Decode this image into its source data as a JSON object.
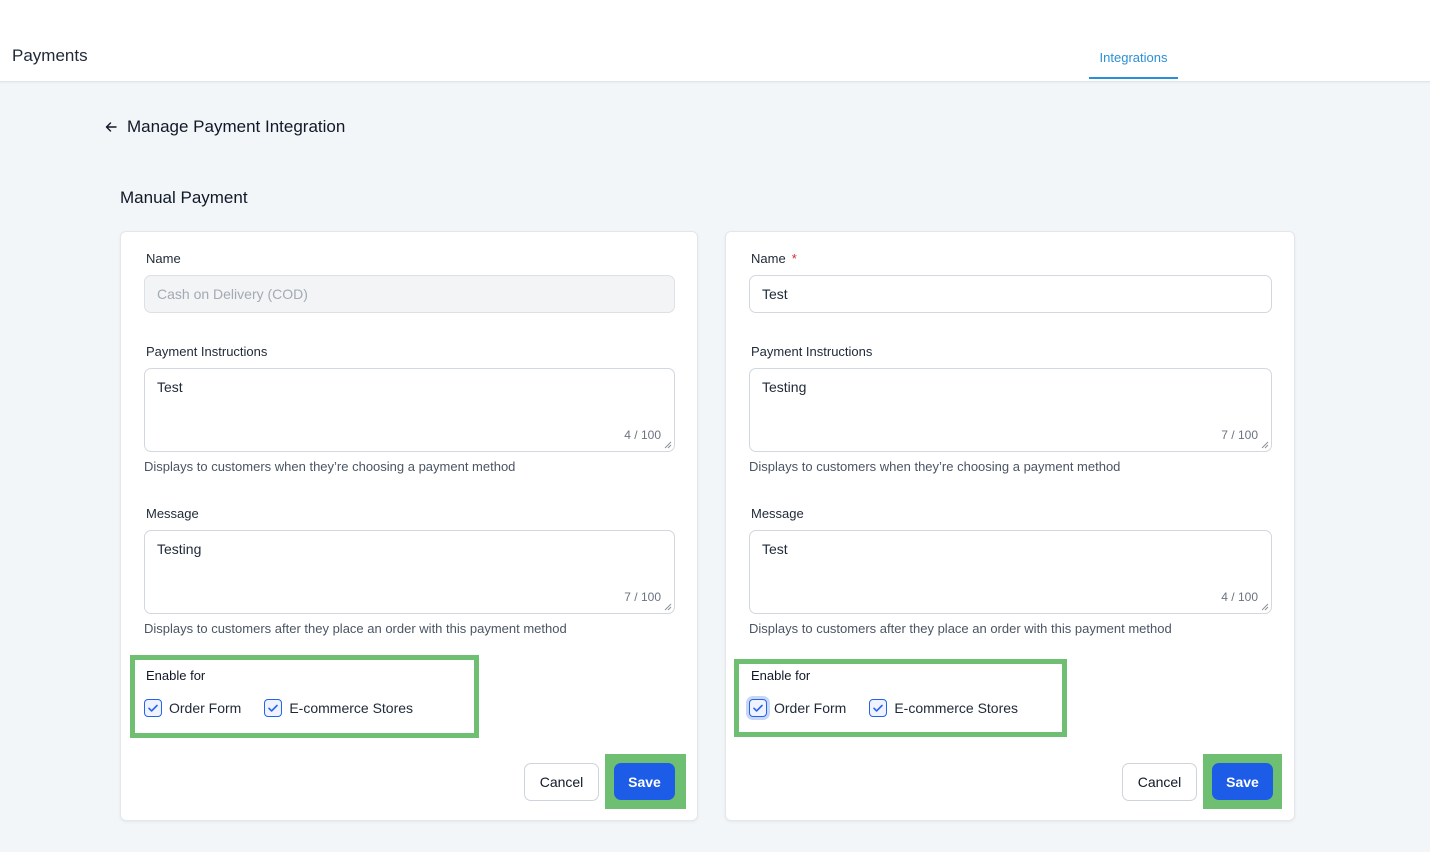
{
  "header": {
    "title": "Payments",
    "tabs": [
      {
        "label": "Integrations",
        "active": true
      }
    ]
  },
  "back": {
    "title": "Manage Payment Integration"
  },
  "section": {
    "title": "Manual Payment"
  },
  "cards": [
    {
      "name_label": "Name",
      "name_value": "Cash on Delivery (COD)",
      "instructions_label": "Payment Instructions",
      "instructions_value": "Test",
      "instructions_count": "4 / 100",
      "instructions_help": "Displays to customers when they’re choosing a payment method",
      "message_label": "Message",
      "message_value": "Testing",
      "message_count": "7 / 100",
      "message_help": "Displays to customers after they place an order with this payment method",
      "enable_title": "Enable for",
      "options": [
        {
          "label": "Order Form",
          "checked": true
        },
        {
          "label": "E-commerce Stores",
          "checked": true
        }
      ],
      "cancel_label": "Cancel",
      "save_label": "Save"
    },
    {
      "name_label": "Name",
      "required_mark": "*",
      "name_value": "Test",
      "instructions_label": "Payment Instructions",
      "instructions_value": "Testing",
      "instructions_count": "7 / 100",
      "instructions_help": "Displays to customers when they’re choosing a payment method",
      "message_label": "Message",
      "message_value": "Test",
      "message_count": "4 / 100",
      "message_help": "Displays to customers after they place an order with this payment method",
      "enable_title": "Enable for",
      "options": [
        {
          "label": "Order Form",
          "checked": true
        },
        {
          "label": "E-commerce Stores",
          "checked": true
        }
      ],
      "cancel_label": "Cancel",
      "save_label": "Save"
    }
  ],
  "colors": {
    "accent": "#1d5ce6",
    "tab_active": "#2a8fd6",
    "highlight": "#6fbf73",
    "required": "#e02424"
  }
}
